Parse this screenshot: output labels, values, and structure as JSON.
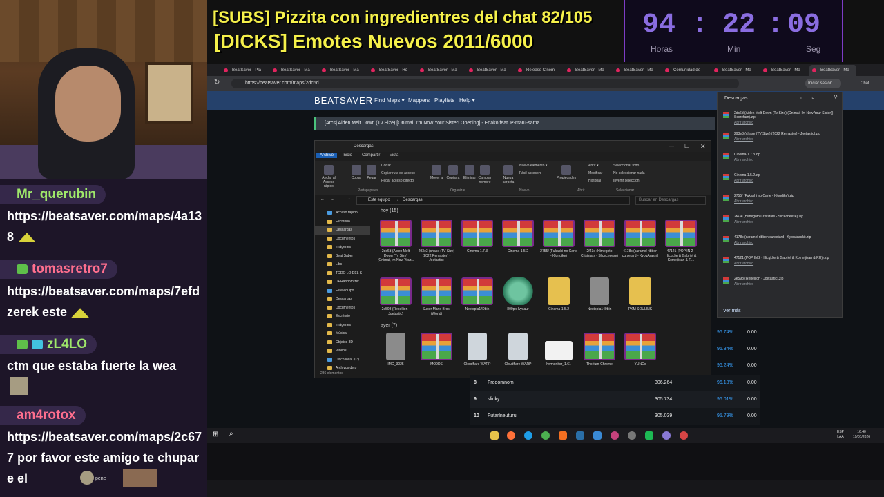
{
  "overlay": {
    "line1": "[SUBS] Pizzita con ingredientres del chat 82/105",
    "line2": "[DICKS] Emotes Nuevos 2011/6000",
    "timer": {
      "hours": "94",
      "minutes": "22",
      "seconds": "09",
      "sep": ":",
      "h_label": "Horas",
      "m_label": "Min",
      "s_label": "Seg"
    }
  },
  "chat": [
    {
      "user": "Mr_querubin",
      "text": "https://beatsaver.com/maps/4a138"
    },
    {
      "user": "tomasretro7",
      "text": "https://beatsaver.com/maps/7efd zerek este"
    },
    {
      "user": "zL4LO",
      "text": "ctm que estaba fuerte la wea"
    },
    {
      "user": "am4rotox",
      "text": "https://beatsaver.com/maps/2c677 por favor este amigo te chupare el",
      "emote_label": "pene"
    }
  ],
  "browser": {
    "tabs": [
      "BeatSaver - Pla",
      "BeatSaver - Ma",
      "BeatSaver - Ma",
      "BeatSaver - Ho",
      "BeatSaver - Ma",
      "BeatSaver - Ma",
      "Release Cinem",
      "BeatSaver - Ma",
      "BeatSaver - Ma",
      "Comunidad de",
      "BeatSaver - Ma",
      "BeatSaver - Ma",
      "BeatSaver - Ma"
    ],
    "url": "https://beatsaver.com/maps/2dc6d",
    "signin": "Iniciar sesión",
    "chat_btn": "Chat"
  },
  "beatsaver": {
    "logo": "BEATSAVER",
    "nav": [
      "Find Maps ▾",
      "Mappers",
      "Playlists",
      "Help ▾"
    ],
    "map_title": "[Arcs] Aiden Melt Down (Tv Size) [Onimai: I'm Now Your Sister! Opening] - Enako feat. P-maru-sama"
  },
  "explorer": {
    "title": "Descargas",
    "ribbon_tabs": [
      "Archivo",
      "Inicio",
      "Compartir",
      "Vista"
    ],
    "ribbon_buttons": [
      "Anclar al Acceso rápido",
      "Copiar",
      "Pegar",
      "Mover a",
      "Copiar a",
      "Eliminar",
      "Cambiar nombre",
      "Nueva carpeta",
      "Propiedades"
    ],
    "ribbon_small": [
      "Cortar",
      "Copiar ruta de acceso",
      "Pegar acceso directo",
      "Nuevo elemento ▾",
      "Fácil acceso ▾",
      "Abrir ▾",
      "Modificar",
      "Historial",
      "Seleccionar todo",
      "No seleccionar nada",
      "Invertir selección"
    ],
    "ribbon_groups": [
      "Portapapeles",
      "Organizar",
      "Nuevo",
      "Abrir",
      "Seleccionar"
    ],
    "path": [
      "Este equipo",
      "Descargas"
    ],
    "search_placeholder": "Buscar en Descargas",
    "sidebar": [
      "Acceso rápido",
      "Escritorio",
      "Descargas",
      "Documentos",
      "Imágenes",
      "Beat Saber",
      "Libs",
      "TODO LO DEL S",
      "UPRandomizer",
      "Este equipo",
      "Descargas",
      "Documentos",
      "Escritorio",
      "Imágenes",
      "Música",
      "Objetos 3D",
      "Vídeos",
      "Disco local (C:)",
      "Archivos de p"
    ],
    "group_today": "hoy (15)",
    "group_yesterday": "ayer (7)",
    "files_today": [
      "2dc6d (Aiden Melt Down (Tv Size) (Onimai, Im Now Your...",
      "293e3 (chase (TV Size) (2022 Remaster) - Joetastic)",
      "Cinema-1.7.3",
      "Cinema-1.5.2",
      "2755f (Fukashi no Carte - Klondike)",
      "2f43e (Himegoto Crisistars - Slicecheese)",
      "4178c (caramel ribbon cursetard - KyouArashi)",
      "47121 (POP IN 2 - HicqLlie & Gabriel & Komeijisan & R...",
      "2e598 (Rebellion - Joetastic)",
      "Super Mario Bros. (World)",
      "Nestopia140bin",
      "800px-Ivysaur",
      "Cinema-1.5.2",
      "Nestopia140bin",
      "PKM SOULINK"
    ],
    "files_yesterday": [
      "IMG_3025",
      "MO9DS",
      "Cloudflare WARP",
      "Cloudflare WARP",
      "hwmonitor_1.61",
      "Thorium-Chrome",
      "YUNGs"
    ],
    "status": "286 elementos"
  },
  "downloads": {
    "title": "Descargas",
    "items": [
      "2dc6d (Aiden Melt Down (Tv Size) (Onimai, Im Now Your Sister)) - Scorefam).zip",
      "293e3 (chase (TV Size) (2022 Remaster) - Joetastic).zip",
      "Cinema-1.7.3.zip",
      "Cinema-1.5.2.zip",
      "2755f (Fukashi no Carte - Klondike).zip",
      "2f43e (Himegoto Crisistars - Slicecheese).zip",
      "4178c (caramel ribbon cursetard - KyouArashi).zip",
      "47121 (POP IN 2 - HicqLlie & Gabriel & Komeijisan & RU)).zip",
      "2e598 (Rebellion - Joetastic).zip"
    ],
    "open_label": "Abrir archivo",
    "more": "Ver más"
  },
  "leaderboard": {
    "right_rows": [
      [
        "96.74%",
        "0.00"
      ],
      [
        "96.34%",
        "0.00"
      ],
      [
        "96.24%",
        "0.00"
      ]
    ],
    "rows": [
      {
        "rank": "8",
        "name": "Fredomnom",
        "score": "306.264",
        "pct": "96.18%",
        "pp": "0.00"
      },
      {
        "rank": "9",
        "name": "slinky",
        "score": "305.734",
        "pct": "96.01%",
        "pp": "0.00"
      },
      {
        "rank": "10",
        "name": "Futarlneuturu",
        "score": "305.039",
        "pct": "95.79%",
        "pp": "0.00"
      }
    ]
  },
  "taskbar": {
    "lang": "ESP",
    "lang2": "LAA",
    "time": "16:40",
    "date": "19/01/2026"
  },
  "colors": {
    "accent_purple": "#7d3cc5",
    "overlay_text": "#f5f04a",
    "chat_bg": "#1d1528",
    "beatsaver_nav": "#25416b",
    "pct_blue": "#3aa3ff"
  }
}
